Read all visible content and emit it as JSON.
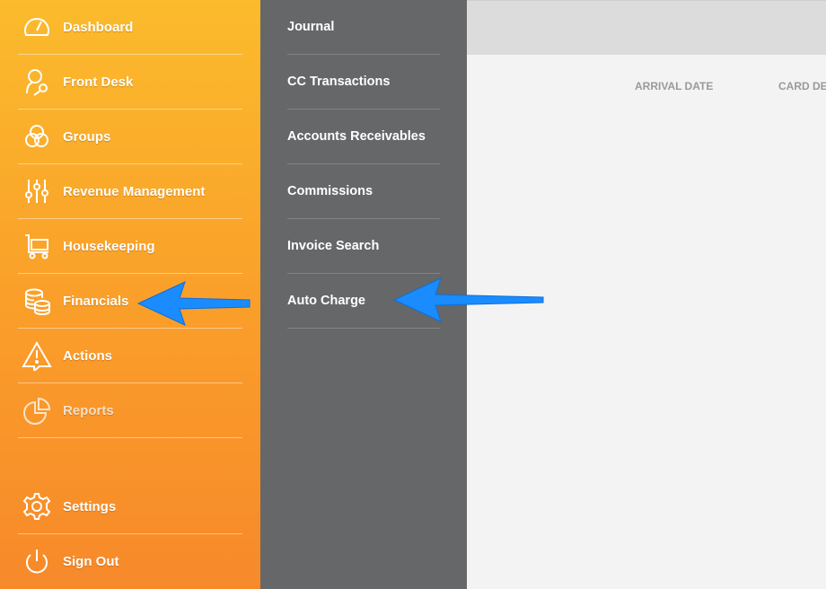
{
  "sidebar": {
    "items": [
      {
        "label": "Dashboard",
        "icon": "speedometer-icon"
      },
      {
        "label": "Front Desk",
        "icon": "person-key-icon"
      },
      {
        "label": "Groups",
        "icon": "groups-circles-icon"
      },
      {
        "label": "Revenue Management",
        "icon": "sliders-icon"
      },
      {
        "label": "Housekeeping",
        "icon": "cart-icon"
      },
      {
        "label": "Financials",
        "icon": "coins-stack-icon"
      },
      {
        "label": "Actions",
        "icon": "warning-icon"
      },
      {
        "label": "Reports",
        "icon": "pie-chart-icon"
      }
    ],
    "bottom_items": [
      {
        "label": "Settings",
        "icon": "gear-icon"
      },
      {
        "label": "Sign Out",
        "icon": "power-icon"
      }
    ]
  },
  "submenu": {
    "items": [
      {
        "label": "Journal"
      },
      {
        "label": "CC Transactions"
      },
      {
        "label": "Accounts Receivables"
      },
      {
        "label": "Commissions"
      },
      {
        "label": "Invoice Search"
      },
      {
        "label": "Auto Charge"
      }
    ]
  },
  "main": {
    "columns": [
      {
        "label": "ARRIVAL DATE"
      },
      {
        "label": "CARD DE"
      }
    ]
  },
  "colors": {
    "sidebar_top": "#fbbb2c",
    "sidebar_bottom": "#f7892a",
    "submenu_bg": "#666769",
    "arrow": "#1a8cff"
  }
}
